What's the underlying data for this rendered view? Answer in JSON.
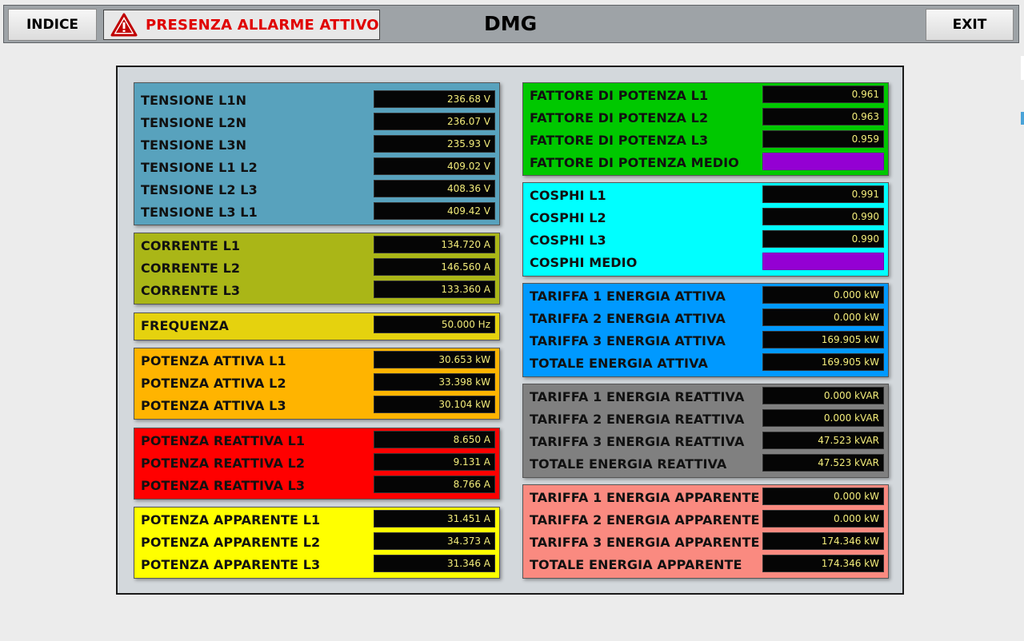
{
  "header": {
    "indice_label": "INDICE",
    "alarm_text": "PRESENZA ALLARME ATTIVO",
    "title": "DMG",
    "exit_label": "EXIT"
  },
  "left_panels": [
    {
      "id": "tensione",
      "color": "#58a2bd",
      "rows": [
        {
          "label": "TENSIONE L1N",
          "value": "236.68 V"
        },
        {
          "label": "TENSIONE L2N",
          "value": "236.07 V"
        },
        {
          "label": "TENSIONE L3N",
          "value": "235.93 V"
        },
        {
          "label": "TENSIONE L1 L2",
          "value": "409.02 V"
        },
        {
          "label": "TENSIONE L2 L3",
          "value": "408.36 V"
        },
        {
          "label": "TENSIONE L3 L1",
          "value": "409.42 V"
        }
      ]
    },
    {
      "id": "corrente",
      "color": "#aab617",
      "rows": [
        {
          "label": "CORRENTE L1",
          "value": "134.720 A"
        },
        {
          "label": "CORRENTE L2",
          "value": "146.560 A"
        },
        {
          "label": "CORRENTE L3",
          "value": "133.360 A"
        }
      ]
    },
    {
      "id": "frequenza",
      "color": "#e5d20e",
      "rows": [
        {
          "label": "FREQUENZA",
          "value": "50.000 Hz"
        }
      ]
    },
    {
      "id": "potenza-attiva",
      "color": "#ffb400",
      "rows": [
        {
          "label": "POTENZA ATTIVA L1",
          "value": "30.653 kW"
        },
        {
          "label": "POTENZA ATTIVA L2",
          "value": "33.398 kW"
        },
        {
          "label": "POTENZA ATTIVA L3",
          "value": "30.104 kW"
        }
      ]
    },
    {
      "id": "potenza-reattiva",
      "color": "#ff0000",
      "rows": [
        {
          "label": "POTENZA REATTIVA L1",
          "value": "8.650 A"
        },
        {
          "label": "POTENZA REATTIVA L2",
          "value": "9.131 A"
        },
        {
          "label": "POTENZA REATTIVA L3",
          "value": "8.766 A"
        }
      ]
    },
    {
      "id": "potenza-apparente",
      "color": "#ffff00",
      "rows": [
        {
          "label": "POTENZA APPARENTE L1",
          "value": "31.451 A"
        },
        {
          "label": "POTENZA APPARENTE L2",
          "value": "34.373 A"
        },
        {
          "label": "POTENZA APPARENTE L3",
          "value": "31.346 A"
        }
      ]
    }
  ],
  "right_panels": [
    {
      "id": "fattore-potenza",
      "color": "#00c800",
      "rows": [
        {
          "label": "FATTORE DI POTENZA L1",
          "value": "0.961"
        },
        {
          "label": "FATTORE DI POTENZA L2",
          "value": "0.963"
        },
        {
          "label": "FATTORE DI POTENZA L3",
          "value": "0.959"
        },
        {
          "label": "FATTORE DI POTENZA MEDIO",
          "value": ""
        }
      ]
    },
    {
      "id": "cosphi",
      "color": "#00ffff",
      "rows": [
        {
          "label": "COSPHI L1",
          "value": "0.991"
        },
        {
          "label": "COSPHI L2",
          "value": "0.990"
        },
        {
          "label": "COSPHI L3",
          "value": "0.990"
        },
        {
          "label": "COSPHI MEDIO",
          "value": ""
        }
      ]
    },
    {
      "id": "energia-attiva",
      "color": "#0099ff",
      "rows": [
        {
          "label": "TARIFFA 1 ENERGIA ATTIVA",
          "value": "0.000 kW"
        },
        {
          "label": "TARIFFA 2 ENERGIA ATTIVA",
          "value": "0.000 kW"
        },
        {
          "label": "TARIFFA 3 ENERGIA ATTIVA",
          "value": "169.905 kW"
        },
        {
          "label": "TOTALE ENERGIA ATTIVA",
          "value": "169.905 kW"
        }
      ]
    },
    {
      "id": "energia-reattiva",
      "color": "#808080",
      "rows": [
        {
          "label": "TARIFFA 1 ENERGIA REATTIVA",
          "value": "0.000 kVAR"
        },
        {
          "label": "TARIFFA 2 ENERGIA REATTIVA",
          "value": "0.000 kVAR"
        },
        {
          "label": "TARIFFA 3 ENERGIA REATTIVA",
          "value": "47.523 kVAR"
        },
        {
          "label": "TOTALE ENERGIA REATTIVA",
          "value": "47.523 kVAR"
        }
      ]
    },
    {
      "id": "energia-apparente",
      "color": "#fa8a80",
      "rows": [
        {
          "label": "TARIFFA 1 ENERGIA APPARENTE",
          "value": "0.000 kW"
        },
        {
          "label": "TARIFFA 2 ENERGIA APPARENTE",
          "value": "0.000 kW"
        },
        {
          "label": "TARIFFA 3 ENERGIA APPARENTE",
          "value": "174.346 kW"
        },
        {
          "label": "TOTALE ENERGIA APPARENTE",
          "value": "174.346 kW"
        }
      ]
    }
  ],
  "colors": {
    "value_text": "#f3ec7a",
    "empty_value": "#9400d3",
    "alarm": "#e00000"
  },
  "icons": {
    "alarm": "warning-triangle-icon"
  }
}
